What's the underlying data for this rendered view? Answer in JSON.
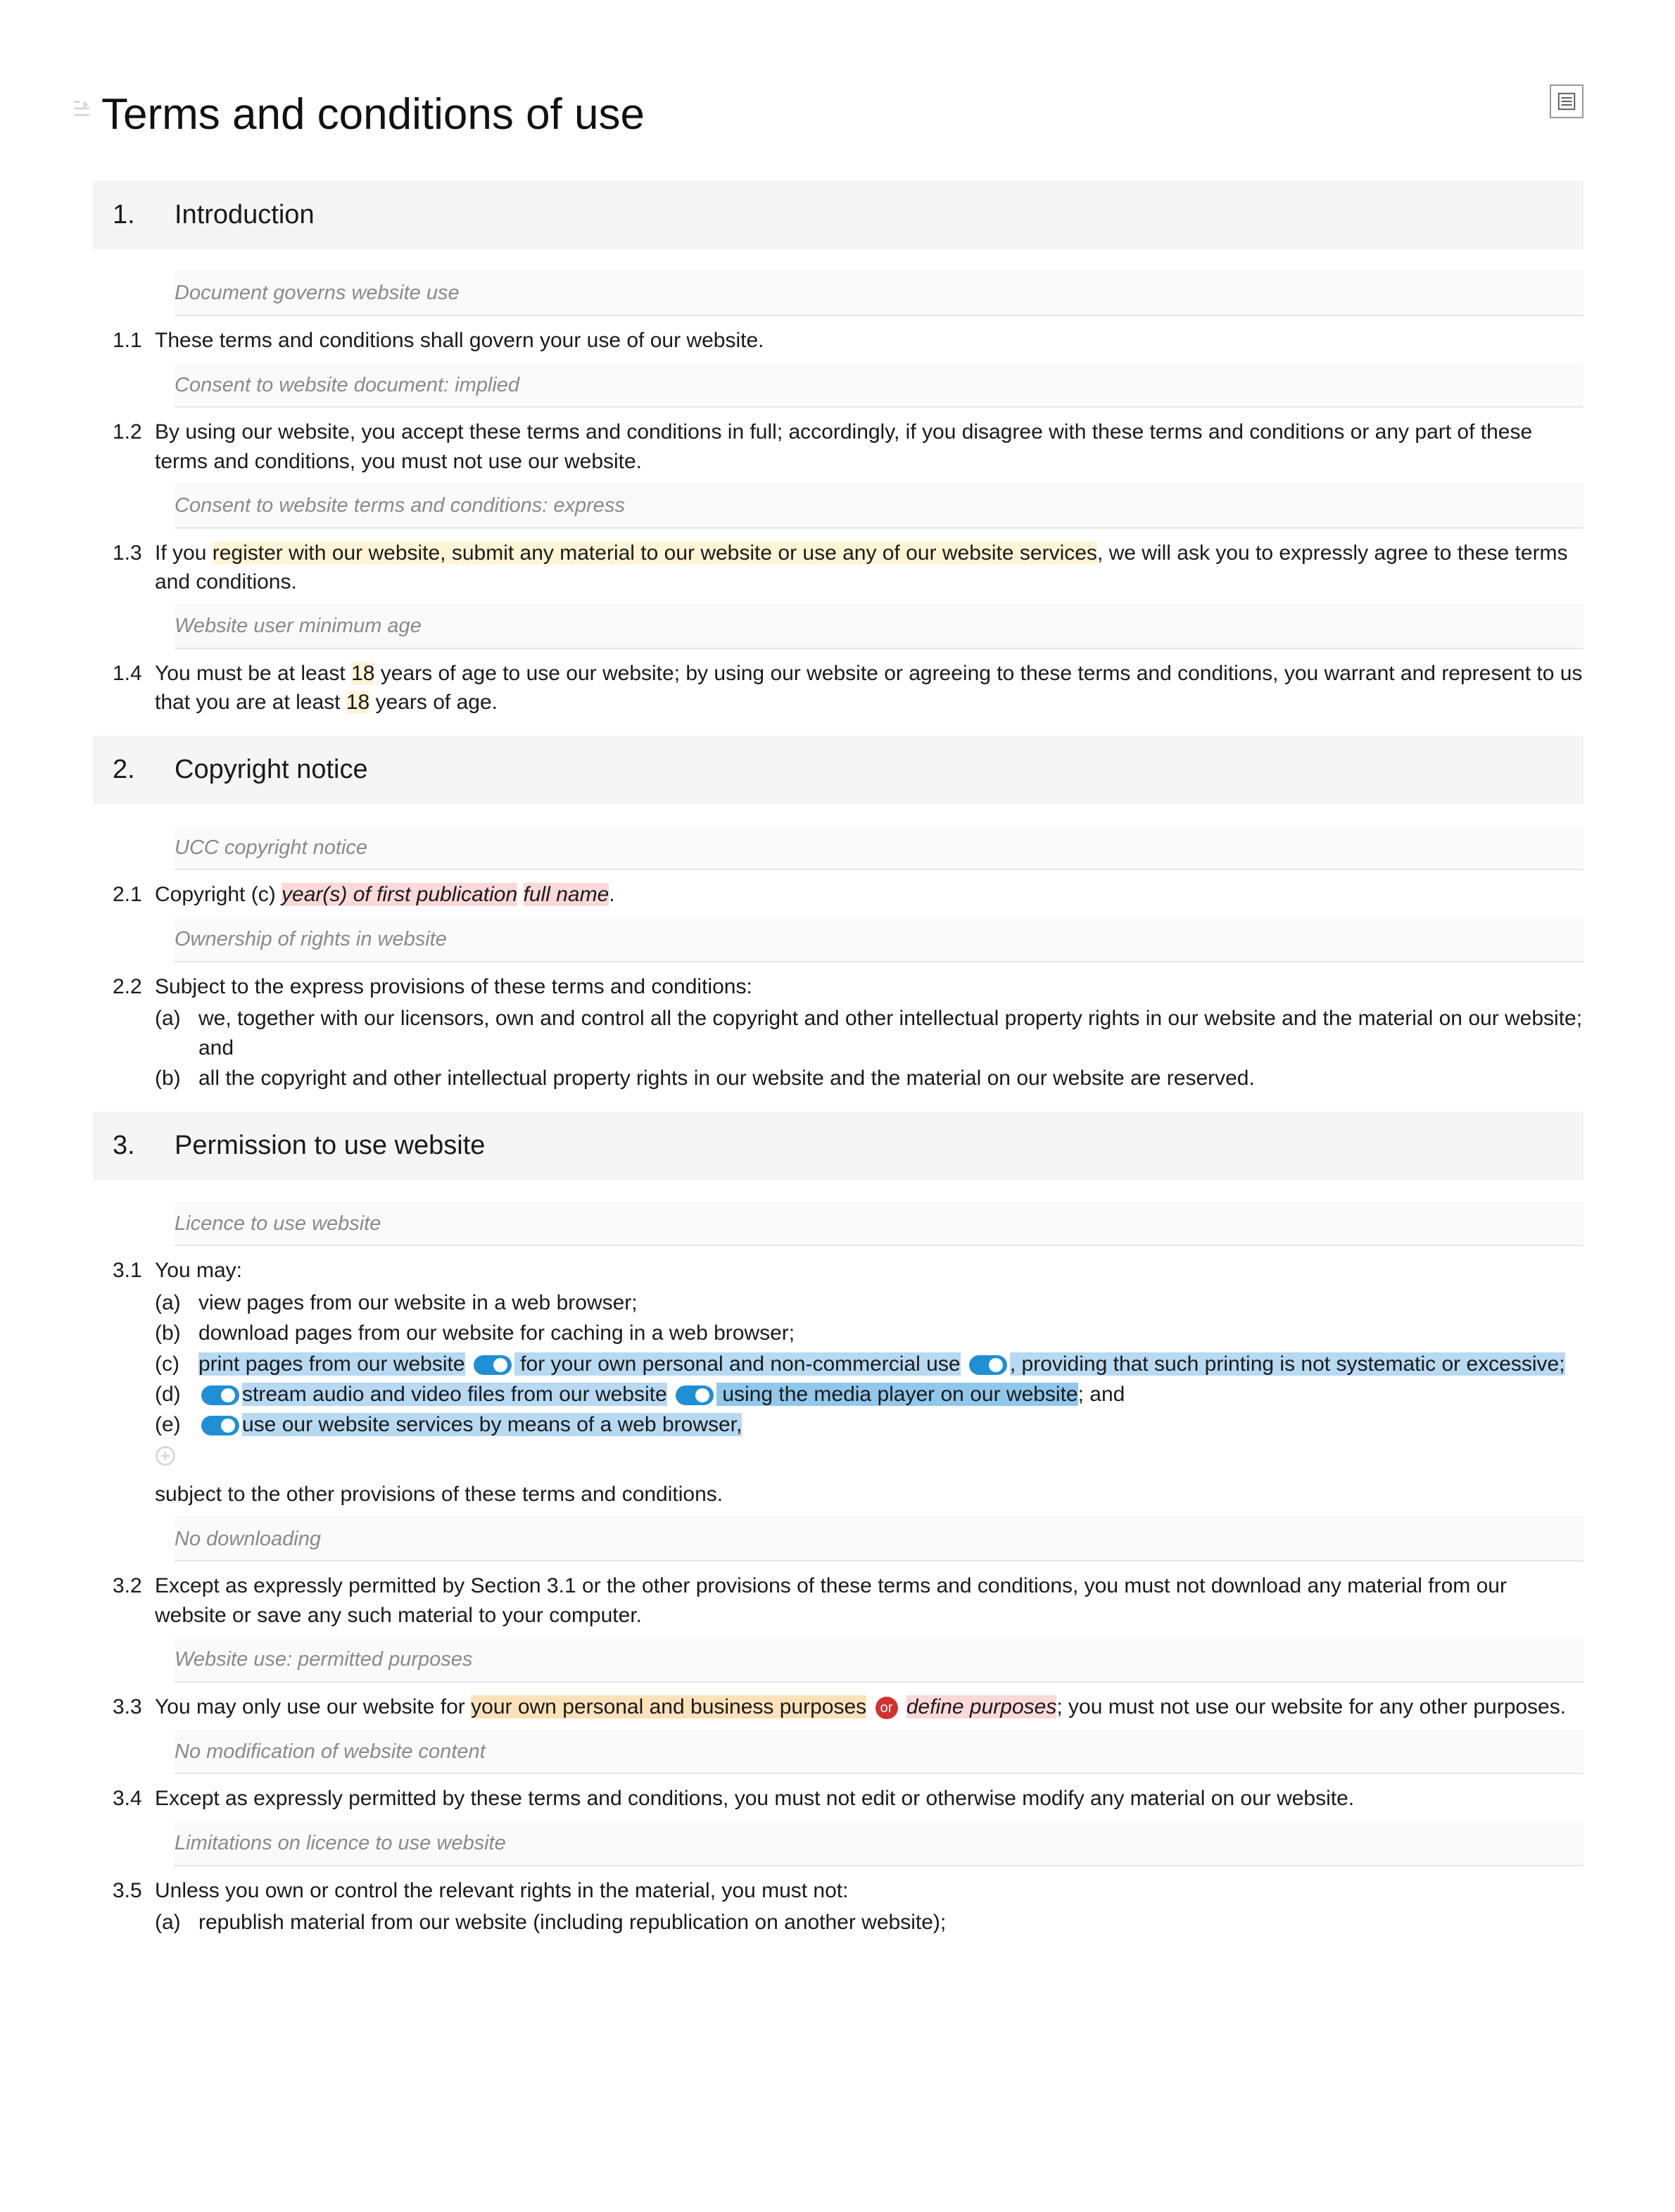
{
  "title": "Terms and conditions of use",
  "or_label": "or",
  "sections": {
    "s1": {
      "num": "1.",
      "title": "Introduction"
    },
    "s2": {
      "num": "2.",
      "title": "Copyright notice"
    },
    "s3": {
      "num": "3.",
      "title": "Permission to use website"
    }
  },
  "captions": {
    "c11": "Document governs website use",
    "c12": "Consent to website document: implied",
    "c13": "Consent to website terms and conditions: express",
    "c14": "Website user minimum age",
    "c21": "UCC copyright notice",
    "c22": "Ownership of rights in website",
    "c31": "Licence to use website",
    "c32": "No downloading",
    "c33": "Website use: permitted purposes",
    "c34": "No modification of website content",
    "c35": "Limitations on licence to use website"
  },
  "clauses": {
    "n11": "1.1",
    "t11": "These terms and conditions shall govern your use of our website.",
    "n12": "1.2",
    "t12": "By using our website, you accept these terms and conditions in full; accordingly, if you disagree with these terms and conditions or any part of these terms and conditions, you must not use our website.",
    "n13": "1.3",
    "t13a": "If you ",
    "t13b": "register with our website, submit any material to our website or use any of our website services",
    "t13c": ", we will ask you to expressly agree to these terms and conditions.",
    "n14": "1.4",
    "t14a": "You must be at least ",
    "t14b": "18",
    "t14c": " years of age to use our website; by using our website or agreeing to these terms and conditions, you warrant and represent to us that you are at least ",
    "t14d": "18",
    "t14e": " years of age.",
    "n21": "2.1",
    "t21a": "Copyright (c) ",
    "t21b": "year(s) of first publication",
    "t21c": " ",
    "t21d": "full name",
    "t21e": ".",
    "n22": "2.2",
    "t22": "Subject to the express provisions of these terms and conditions:",
    "t22a_l": "(a)",
    "t22a": "we, together with our licensors, own and control all the copyright and other intellectual property rights in our website and the material on our website; and",
    "t22b_l": "(b)",
    "t22b": "all the copyright and other intellectual property rights in our website and the material on our website are reserved.",
    "n31": "3.1",
    "t31": "You may:",
    "t31a_l": "(a)",
    "t31a": "view pages from our website in a web browser;",
    "t31b_l": "(b)",
    "t31b": "download pages from our website for caching in a web browser;",
    "t31c_l": "(c)",
    "t31c1": "print pages from our website",
    "t31c2": " for your own personal and non-commercial use",
    "t31c3": ", providing that such printing is not systematic or excessive;",
    "t31d_l": "(d)",
    "t31d1": "stream audio and video files from our website",
    "t31d2": " using the media player on our website",
    "t31d3": "; and",
    "t31e_l": "(e)",
    "t31e1": "use our website services by means of a web browser,",
    "t31tail": "subject to the other provisions of these terms and conditions.",
    "n32": "3.2",
    "t32": "Except as expressly permitted by Section 3.1 or the other provisions of these terms and conditions, you must not download any material from our website or save any such material to your computer.",
    "n33": "3.3",
    "t33a": "You may only use our website for ",
    "t33b": "your own personal and business purposes",
    "t33c": "define purposes",
    "t33d": "; you must not use our website for any other purposes.",
    "n34": "3.4",
    "t34": "Except as expressly permitted by these terms and conditions, you must not edit or otherwise modify any material on our website.",
    "n35": "3.5",
    "t35": "Unless you own or control the relevant rights in the material, you must not:",
    "t35a_l": "(a)",
    "t35a": "republish material from our website (including republication on another website);"
  }
}
